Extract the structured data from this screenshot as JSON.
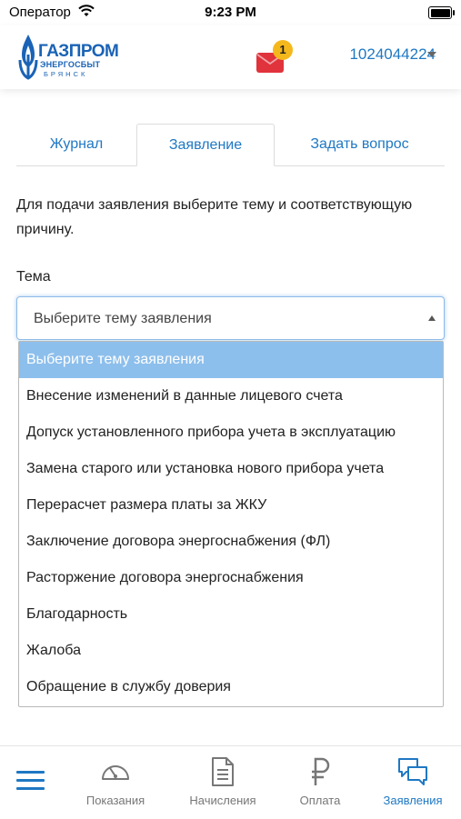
{
  "status_bar": {
    "carrier": "Оператор",
    "time": "9:23 PM"
  },
  "header": {
    "logo": {
      "main": "ГАЗПРОМ",
      "sub": "ЭНЕРГОСБЫТ",
      "city": "БРЯНСК"
    },
    "mail_badge": "1",
    "account_number": "1024044224"
  },
  "tabs": [
    {
      "label": "Журнал"
    },
    {
      "label": "Заявление"
    },
    {
      "label": "Задать вопрос"
    }
  ],
  "intro_text": "Для подачи заявления выберите тему и соответствующую причину.",
  "topic": {
    "label": "Тема",
    "selected_value": "Выберите тему заявления",
    "options": [
      "Выберите тему заявления",
      "Внесение изменений в данные лицевого счета",
      "Допуск установленного прибора учета в эксплуатацию",
      "Замена старого или установка нового прибора учета",
      "Перерасчет размера платы за ЖКУ",
      "Заключение договора энергоснабжения (ФЛ)",
      "Расторжение договора энергоснабжения",
      "Благодарность",
      "Жалоба",
      "Обращение в службу доверия"
    ]
  },
  "bottom_nav": {
    "items": [
      {
        "label": "Показания",
        "icon": "gauge-icon"
      },
      {
        "label": "Начисления",
        "icon": "document-icon"
      },
      {
        "label": "Оплата",
        "icon": "ruble-icon"
      },
      {
        "label": "Заявления",
        "icon": "chat-bubbles-icon"
      }
    ]
  },
  "colors": {
    "accent": "#1f78c3",
    "badge": "#f5b81c",
    "mail": "#e0333c",
    "selected_option": "#8dbfec"
  }
}
